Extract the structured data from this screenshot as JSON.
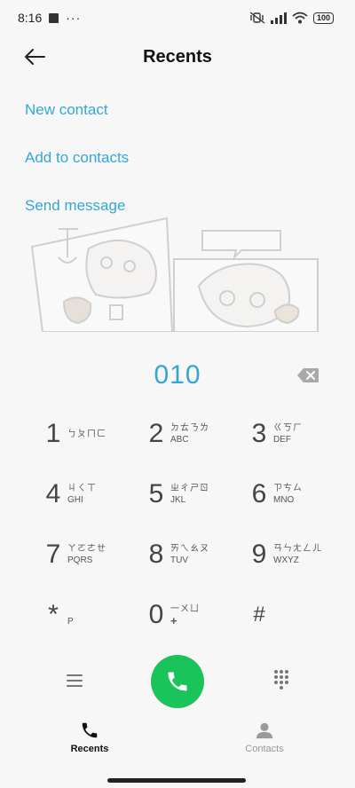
{
  "status_bar": {
    "time": "8:16",
    "overflow": "···",
    "battery": "100",
    "icons": [
      "notification-square-icon",
      "mute-vibrate-icon",
      "signal-icon",
      "wifi-icon",
      "battery-icon"
    ]
  },
  "header": {
    "title": "Recents",
    "back_icon": "arrow-left-icon"
  },
  "actions": {
    "new_contact": "New contact",
    "add_to_contacts": "Add to contacts",
    "send_message": "Send message"
  },
  "dialer": {
    "number": "010",
    "backspace_icon": "backspace-icon"
  },
  "keys": [
    {
      "digit": "1",
      "zhuyin": "ㄅㄆㄇㄈ",
      "letters": ""
    },
    {
      "digit": "2",
      "zhuyin": "ㄉㄊㄋㄌ",
      "letters": "ABC"
    },
    {
      "digit": "3",
      "zhuyin": "ㄍㄎㄏ",
      "letters": "DEF"
    },
    {
      "digit": "4",
      "zhuyin": "ㄐㄑㄒ",
      "letters": "GHI"
    },
    {
      "digit": "5",
      "zhuyin": "ㄓㄔㄕㄖ",
      "letters": "JKL"
    },
    {
      "digit": "6",
      "zhuyin": "ㄗㄘㄙ",
      "letters": "MNO"
    },
    {
      "digit": "7",
      "zhuyin": "ㄚㄛㄜㄝ",
      "letters": "PQRS"
    },
    {
      "digit": "8",
      "zhuyin": "ㄞㄟㄠㄡ",
      "letters": "TUV"
    },
    {
      "digit": "9",
      "zhuyin": "ㄢㄣㄤㄥㄦ",
      "letters": "WXYZ"
    },
    {
      "digit": "*",
      "zhuyin": "",
      "letters": "P"
    },
    {
      "digit": "0",
      "zhuyin": "一ㄨㄩ",
      "letters": "+"
    },
    {
      "digit": "#",
      "zhuyin": "",
      "letters": ""
    }
  ],
  "controls": {
    "menu_icon": "hamburger-menu-icon",
    "call_icon": "phone-icon",
    "dialpad_icon": "dialpad-icon"
  },
  "bottom_nav": {
    "recents_label": "Recents",
    "contacts_label": "Contacts",
    "active": "Recents"
  },
  "colors": {
    "accent": "#35a7d6",
    "call_green": "#1ac45a",
    "background": "#f7f7f7"
  }
}
